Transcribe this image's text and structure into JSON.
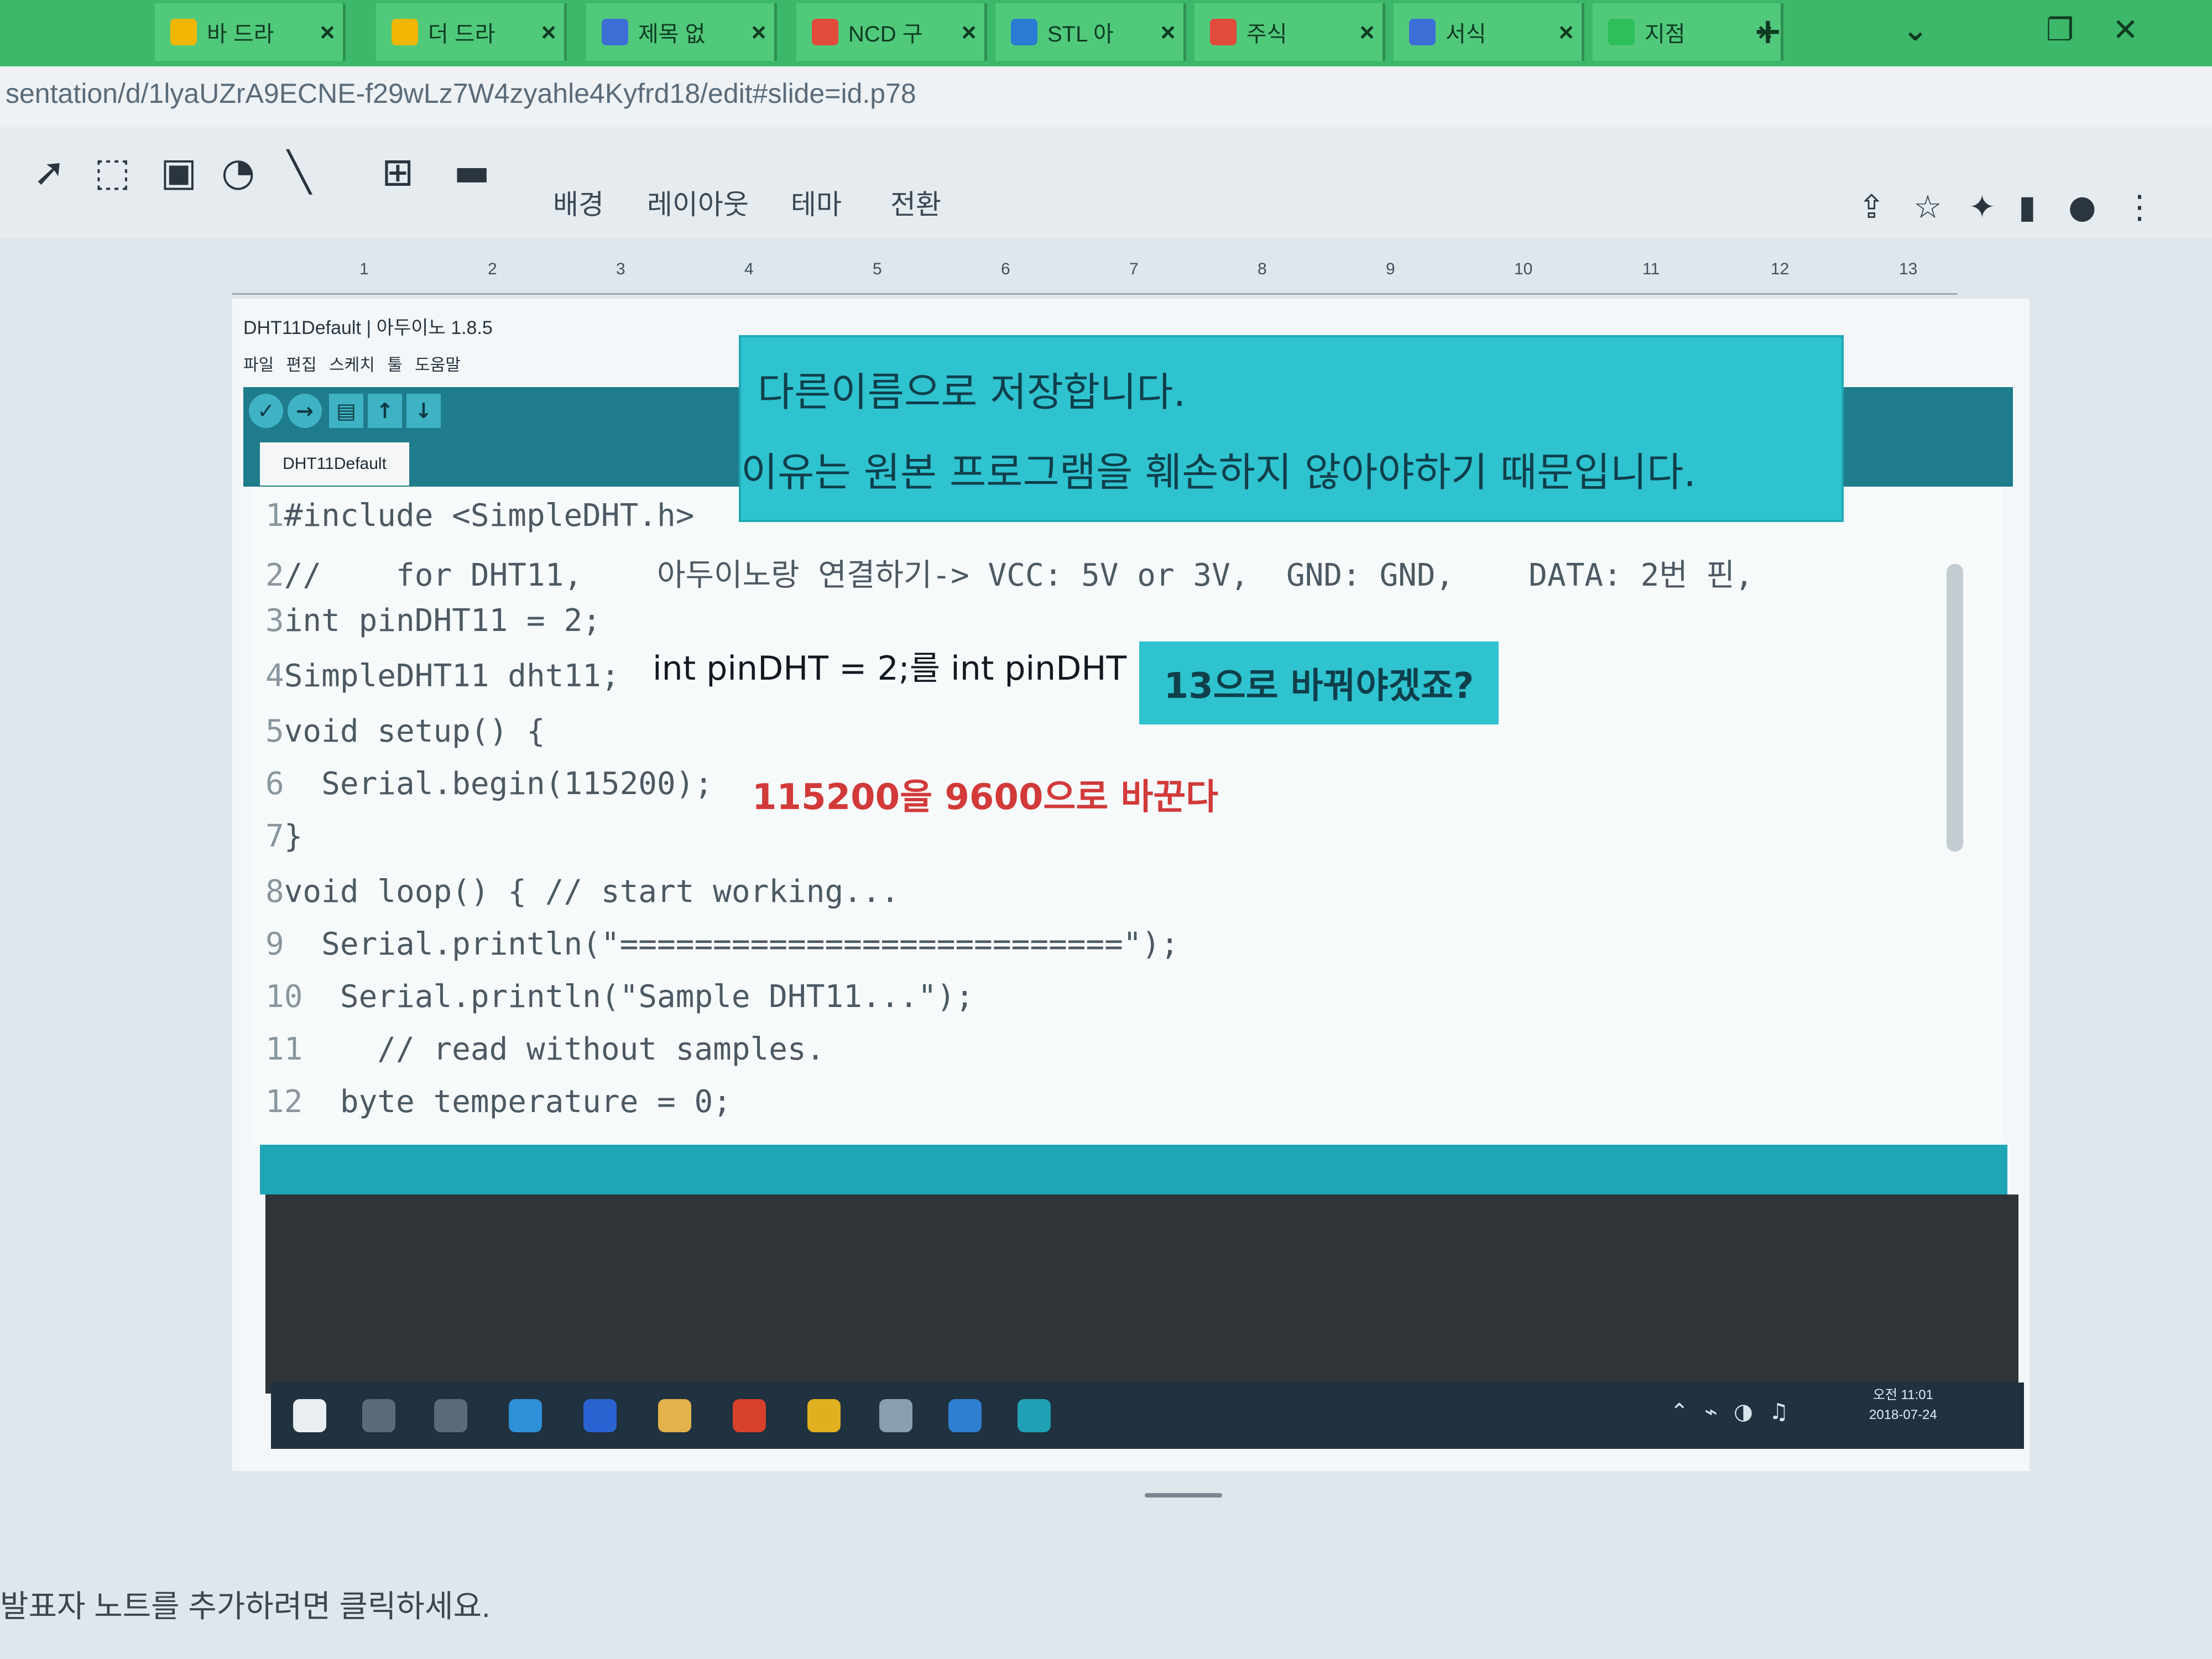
{
  "browser": {
    "tabs": [
      {
        "label": "바 드라",
        "color": "#f2b705"
      },
      {
        "label": "더 드라",
        "color": "#f2b705"
      },
      {
        "label": "제목 없",
        "color": "#3b6fd6"
      },
      {
        "label": "NCD 구",
        "color": "#e24a3b"
      },
      {
        "label": "STL 아",
        "color": "#2a7bd3"
      },
      {
        "label": "주식",
        "color": "#e24a3b"
      },
      {
        "label": "서식",
        "color": "#3b6fd6"
      },
      {
        "label": "지점",
        "color": "#2fbf5a"
      }
    ],
    "address": "sentation/d/1lyaUZrA9ECNE-f29wLz7W4zyahle4Kyfrd18/edit#slide=id.p78",
    "new_tab": "+",
    "window_controls": {
      "minimize": "⌄",
      "maximize": "❐",
      "close": "✕"
    }
  },
  "slides_toolbar": {
    "tools": [
      "select-arrow",
      "text-box",
      "image",
      "shape",
      "line"
    ],
    "menus": [
      "배경",
      "레이아웃",
      "테마",
      "전환"
    ]
  },
  "ruler": {
    "marks": [
      "1",
      "2",
      "3",
      "4",
      "5",
      "6",
      "7",
      "8",
      "9",
      "10",
      "11",
      "12",
      "13"
    ]
  },
  "ide": {
    "title": "DHT11Default | 아두이노 1.8.5",
    "menu": "파일 편집 스케치 툴 도움말",
    "sketch_tab": "DHT11Default"
  },
  "code_lines": [
    {
      "n": "1",
      "text": "#include <SimpleDHT.h>"
    },
    {
      "n": "2",
      "text": "//    for DHT11,    아두이노랑 연결하기-> VCC: 5V or 3V,  GND: GND,    DATA: 2번 핀,"
    },
    {
      "n": "3",
      "text": "int pinDHT11 = 2;"
    },
    {
      "n": "4",
      "text": "SimpleDHT11 dht11;"
    },
    {
      "n": "5",
      "text": "void setup() {"
    },
    {
      "n": "6",
      "text": "  Serial.begin(115200);"
    },
    {
      "n": "7",
      "text": "}"
    },
    {
      "n": "8",
      "text": "void loop() { // start working..."
    },
    {
      "n": "9",
      "text": "  Serial.println(\"===========================\");"
    },
    {
      "n": "10",
      "text": "  Serial.println(\"Sample DHT11...\");"
    },
    {
      "n": "11",
      "text": "    // read without samples."
    },
    {
      "n": "12",
      "text": "  byte temperature = 0;"
    }
  ],
  "annotations": {
    "rename_line1": "다른이름으로 저장합니다.",
    "rename_line2": "이유는 원본 프로그램을 훼손하지 않아야하기 때문입니다.",
    "pin_change": "int pinDHT = 2;를 int pinDHT =",
    "pin_change_box": "13으로 바꿔야겠죠?",
    "baud_change": "115200을 9600으로 바꾼다"
  },
  "taskbar": {
    "time": "오전 11:01",
    "date": "2018-07-24"
  },
  "speaker_notes": "발표자 노트를 추가하려면 클릭하세요."
}
